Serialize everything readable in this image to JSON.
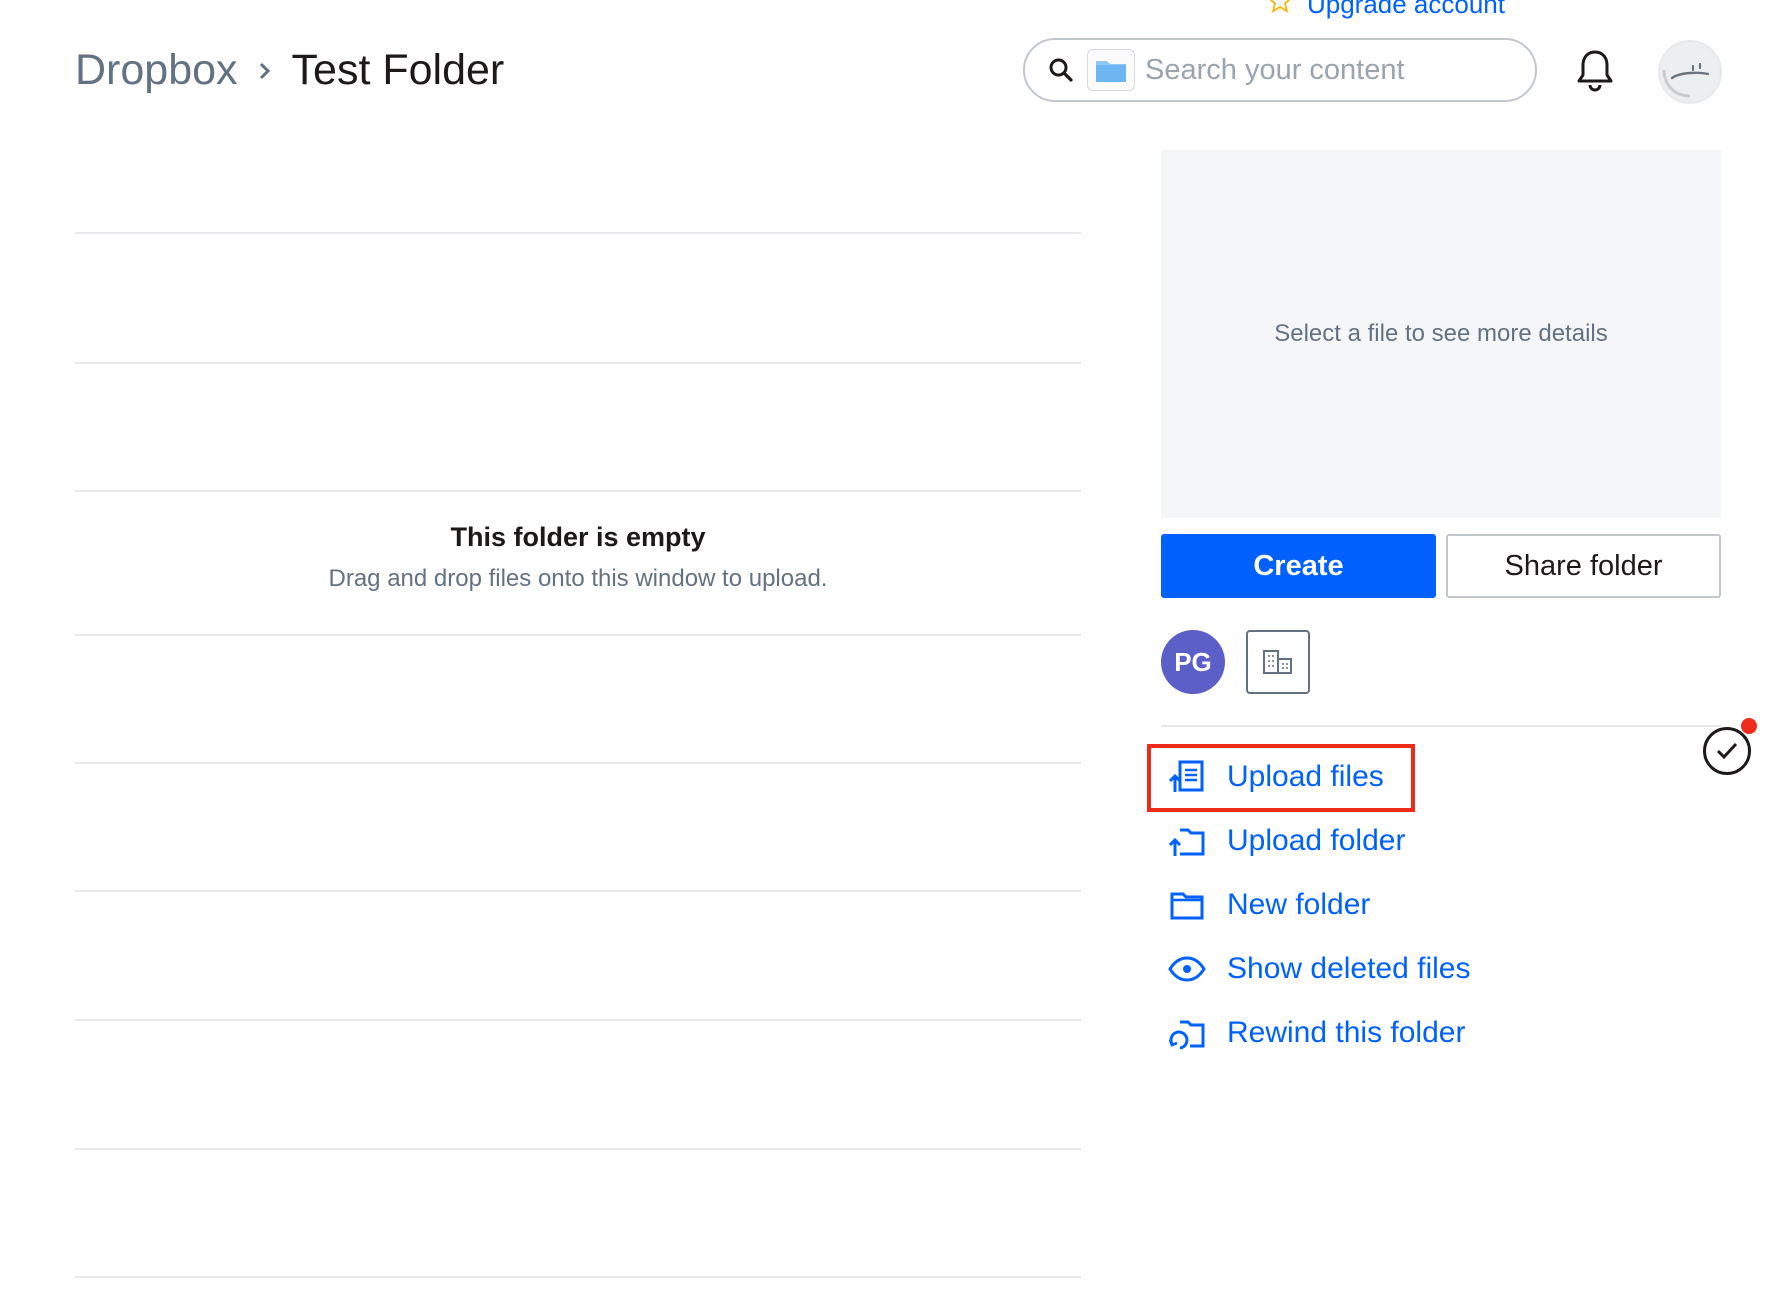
{
  "header": {
    "upgrade_label": "Upgrade account",
    "breadcrumb": {
      "root": "Dropbox",
      "current": "Test Folder"
    },
    "search": {
      "placeholder": "Search your content",
      "value": ""
    }
  },
  "file_list": {
    "empty_title": "This folder is empty",
    "empty_subtitle": "Drag and drop files onto this window to upload."
  },
  "sidebar": {
    "details_placeholder": "Select a file to see more details",
    "create_label": "Create",
    "share_label": "Share folder",
    "member_initials": "PG",
    "actions": [
      {
        "label": "Upload files",
        "icon": "upload-file-icon"
      },
      {
        "label": "Upload folder",
        "icon": "upload-folder-icon"
      },
      {
        "label": "New folder",
        "icon": "folder-icon"
      },
      {
        "label": "Show deleted files",
        "icon": "eye-icon"
      },
      {
        "label": "Rewind this folder",
        "icon": "rewind-folder-icon"
      }
    ]
  },
  "colors": {
    "accent": "#0061fe",
    "highlight": "#ec2b1b",
    "member_avatar": "#5b5fc7",
    "notification_dot": "#ef2b1b"
  }
}
